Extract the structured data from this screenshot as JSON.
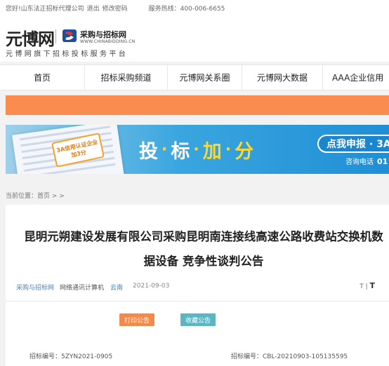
{
  "topbar": {
    "greeting": "您好!山东法正招标代理公司",
    "logout": "退出",
    "change_password": "修改密码",
    "hotline": "服务热线：400-006-6655"
  },
  "header": {
    "logo_yb": "元博网",
    "logo_cb_name": "采购与招标网",
    "logo_cb_url": "WWW.CHINABIDDING.CN",
    "slogan": "元博网旗下招标投标服务平台"
  },
  "nav": {
    "items": [
      {
        "label": "首页"
      },
      {
        "label": "招标采购频道"
      },
      {
        "label": "元博网关系圈"
      },
      {
        "label": "元博网大数据"
      },
      {
        "label": "AAA企业信用"
      }
    ]
  },
  "banner": {
    "badge_line1": "3A信用认证企业",
    "badge_line2": "加3分",
    "title_chars": [
      "投",
      "标",
      "加",
      "分"
    ],
    "apply_label": "点我申报 · 3A",
    "phone_label": "咨询电话",
    "phone_number": "01"
  },
  "breadcrumb": {
    "text": "当前位置：首页 > >"
  },
  "article": {
    "title": "昆明元朔建设发展有限公司采购昆明南连接线高速公路收费站交换机数据设备 竞争性谈判公告",
    "meta": {
      "source": "采购与招标网",
      "category": "网络通讯计算机",
      "region": "云南",
      "date": "2021-09-03"
    },
    "font_small": "T",
    "font_large": "T",
    "print_button": "打印公告",
    "favorite_button": "收藏公告",
    "project_no_left": "招标编号：5ZYN2021-0905",
    "project_no_right": "招标编号：CBL-20210903-105135595"
  },
  "colors": {
    "orange_bar": "#f98c4f",
    "print_button": "#f5884b",
    "favorite_button": "#59b6c2",
    "link_blue": "#4a7fb8",
    "banner_yellow": "#ffd52e"
  }
}
